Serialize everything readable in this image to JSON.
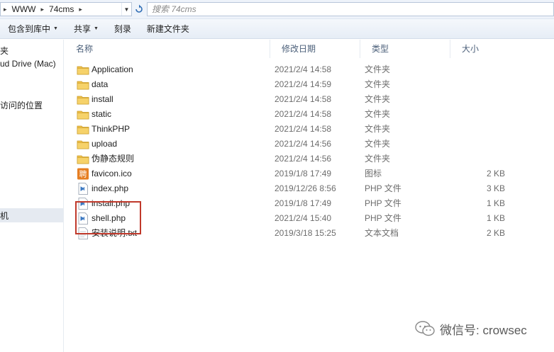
{
  "address": {
    "crumbs": [
      "WWW",
      "74cms"
    ]
  },
  "search": {
    "placeholder": "搜索 74cms"
  },
  "toolbar": {
    "include_library": "包含到库中",
    "share": "共享",
    "burn": "刻录",
    "new_folder": "新建文件夹"
  },
  "sidebar": {
    "items": [
      "夹",
      "ud Drive (Mac)",
      "访问的位置",
      "机"
    ]
  },
  "columns": {
    "name": "名称",
    "modified": "修改日期",
    "type": "类型",
    "size": "大小"
  },
  "files": [
    {
      "name": "Application",
      "date": "2021/2/4 14:58",
      "type": "文件夹",
      "size": "",
      "icon": "folder-icon"
    },
    {
      "name": "data",
      "date": "2021/2/4 14:59",
      "type": "文件夹",
      "size": "",
      "icon": "folder-icon"
    },
    {
      "name": "install",
      "date": "2021/2/4 14:58",
      "type": "文件夹",
      "size": "",
      "icon": "folder-icon"
    },
    {
      "name": "static",
      "date": "2021/2/4 14:58",
      "type": "文件夹",
      "size": "",
      "icon": "folder-icon"
    },
    {
      "name": "ThinkPHP",
      "date": "2021/2/4 14:58",
      "type": "文件夹",
      "size": "",
      "icon": "folder-icon"
    },
    {
      "name": "upload",
      "date": "2021/2/4 14:56",
      "type": "文件夹",
      "size": "",
      "icon": "folder-icon"
    },
    {
      "name": "伪静态规则",
      "date": "2021/2/4 14:56",
      "type": "文件夹",
      "size": "",
      "icon": "folder-icon"
    },
    {
      "name": "favicon.ico",
      "date": "2019/1/8 17:49",
      "type": "图标",
      "size": "2 KB",
      "icon": "favicon-icon"
    },
    {
      "name": "index.php",
      "date": "2019/12/26 8:56",
      "type": "PHP 文件",
      "size": "3 KB",
      "icon": "php-file-icon"
    },
    {
      "name": "install.php",
      "date": "2019/1/8 17:49",
      "type": "PHP 文件",
      "size": "1 KB",
      "icon": "php-file-icon"
    },
    {
      "name": "shell.php",
      "date": "2021/2/4 15:40",
      "type": "PHP 文件",
      "size": "1 KB",
      "icon": "php-file-icon"
    },
    {
      "name": "安装说明.txt",
      "date": "2019/3/18 15:25",
      "type": "文本文档",
      "size": "2 KB",
      "icon": "text-file-icon"
    }
  ],
  "watermark": {
    "text": "微信号: crowsec"
  },
  "colors": {
    "highlight": "#c0392b",
    "folder": "#f0c14b",
    "header_text": "#4c607a"
  }
}
